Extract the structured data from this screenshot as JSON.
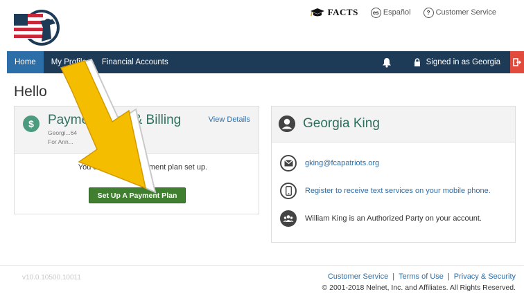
{
  "header": {
    "facts_label": "FACTS",
    "espanol_badge": "es",
    "espanol_label": "Español",
    "help_badge": "?",
    "customer_service_label": "Customer Service"
  },
  "nav": {
    "items": [
      {
        "label": "Home",
        "active": true
      },
      {
        "label": "My Profile",
        "active": false
      },
      {
        "label": "Financial Accounts",
        "active": false
      }
    ],
    "signed_in": "Signed in as Georgia"
  },
  "greeting": "Hello",
  "billing_card": {
    "title": "Payment Plan & Billing",
    "subtitle1": "Georgi...64",
    "subtitle2": "For Ann...",
    "view_details": "View Details",
    "message": "You don't have a payment plan set up.",
    "button_label": "Set Up A Payment Plan"
  },
  "profile_card": {
    "name": "Georgia King",
    "email": "gking@fcapatriots.org",
    "text_services": "Register to receive text services on your mobile phone.",
    "authorized": "William King is an Authorized Party on your account."
  },
  "footer": {
    "version": "v10.0.10500.10011",
    "links": [
      "Customer Service",
      "Terms of Use",
      "Privacy & Security"
    ],
    "separator": "|",
    "copyright": "© 2001-2018 Nelnet, Inc. and Affiliates. All Rights Reserved."
  },
  "colors": {
    "nav_bg": "#1d3a57",
    "nav_active": "#2b6ea8",
    "accent_green": "#2c6f5e",
    "button_green": "#3f7f2f",
    "logout_red": "#e24a3b",
    "arrow_yellow": "#f5bd00"
  }
}
